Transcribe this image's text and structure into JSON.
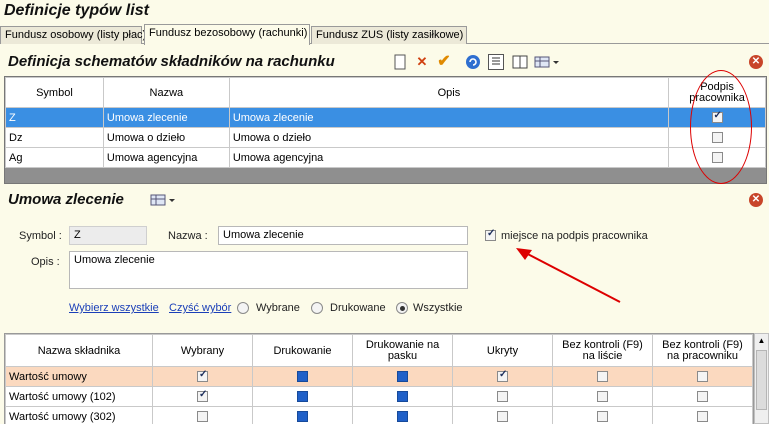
{
  "window": {
    "title": "Definicje typów list"
  },
  "tabs": [
    {
      "label": "Fundusz osobowy (listy płac)"
    },
    {
      "label": "Fundusz bezosobowy (rachunki)"
    },
    {
      "label": "Fundusz ZUS (listy zasiłkowe)"
    }
  ],
  "section1": {
    "title": "Definicja schematów składników na rachunku",
    "columns": [
      "Symbol",
      "Nazwa",
      "Opis",
      "Podpis pracownika"
    ],
    "rows": [
      {
        "symbol": "Z",
        "nazwa": "Umowa zlecenie",
        "opis": "Umowa zlecenie",
        "podpis": true
      },
      {
        "symbol": "Dz",
        "nazwa": "Umowa o dzieło",
        "opis": "Umowa o dzieło",
        "podpis": false
      },
      {
        "symbol": "Ag",
        "nazwa": "Umowa agencyjna",
        "opis": "Umowa agencyjna",
        "podpis": false
      }
    ]
  },
  "section2": {
    "title": "Umowa zlecenie",
    "symbol_label": "Symbol :",
    "symbol_value": "Z",
    "nazwa_label": "Nazwa :",
    "nazwa_value": "Umowa zlecenie",
    "opis_label": "Opis :",
    "opis_value": "Umowa zlecenie",
    "signature_checkbox_label": "miejsce na podpis pracownika",
    "select_all_link": "Wybierz wszystkie",
    "clear_link": "Czyść wybór",
    "radio_options": [
      "Wybrane",
      "Drukowane",
      "Wszystkie"
    ],
    "radio_selected": "Wszystkie"
  },
  "section3": {
    "columns": [
      "Nazwa składnika",
      "Wybrany",
      "Drukowanie",
      "Drukowanie na pasku",
      "Ukryty",
      "Bez kontroli (F9) na liście",
      "Bez kontroli (F9) na pracowniku"
    ],
    "rows": [
      {
        "nazwa": "Wartość umowy",
        "wybrany": true,
        "ukryty": true
      },
      {
        "nazwa": "Wartość umowy (102)",
        "wybrany": true,
        "ukryty": false
      },
      {
        "nazwa": "Wartość umowy (302)",
        "wybrany": false,
        "ukryty": false
      }
    ]
  },
  "colors": {
    "selection": "#3a8fe3",
    "highlight_row": "#fbd9bf",
    "annotation": "#dd0000",
    "background": "#fcfbe9"
  }
}
